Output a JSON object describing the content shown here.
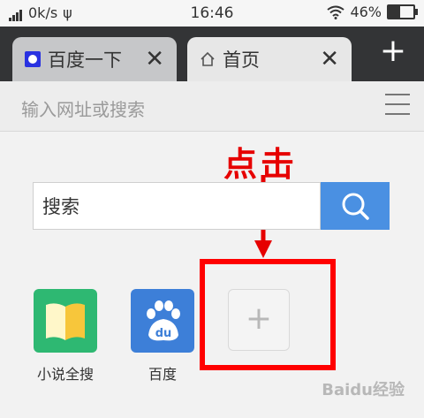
{
  "status_bar": {
    "speed": "0k/s",
    "time": "16:46",
    "battery": "46%"
  },
  "tabs": [
    {
      "label": "百度一下",
      "close": "✕"
    },
    {
      "label": "首页",
      "close": "✕"
    }
  ],
  "new_tab_symbol": "+",
  "address_bar": {
    "placeholder": "输入网址或搜索"
  },
  "search": {
    "value": "搜索"
  },
  "annotation": {
    "text": "点击"
  },
  "tiles": [
    {
      "label": "小说全搜"
    },
    {
      "label": "百度"
    },
    {
      "label": "",
      "symbol": "+"
    }
  ],
  "watermark": "Baidu经验"
}
